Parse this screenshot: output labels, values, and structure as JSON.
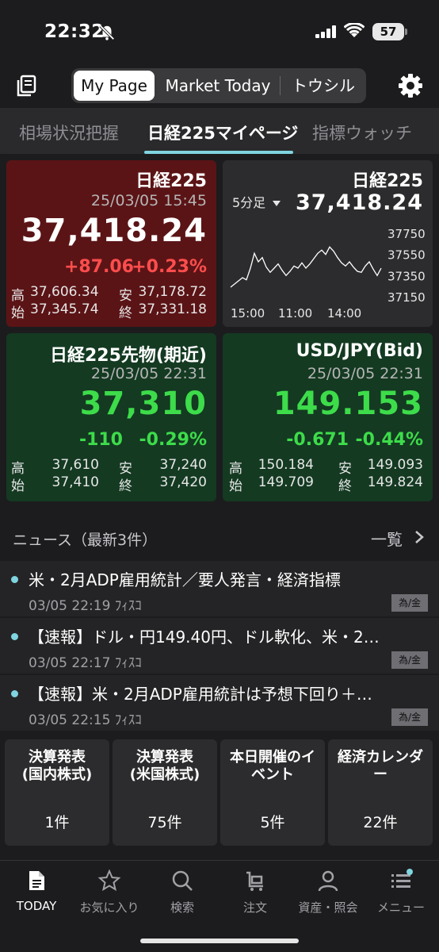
{
  "status": {
    "time": "22:32",
    "battery": "57"
  },
  "topbar": {
    "tabs": [
      {
        "label": "My Page"
      },
      {
        "label": "Market Today"
      },
      {
        "label": "トウシル"
      }
    ]
  },
  "subtabs": [
    {
      "label": "相場状況把握"
    },
    {
      "label": "日経225マイページ"
    },
    {
      "label": "指標ウォッチ"
    }
  ],
  "cards": {
    "nikkei": {
      "title": "日経225",
      "date": "25/03/05 15:45",
      "price": "37,418.24",
      "change": "+87.06",
      "change_pct": "+0.23%",
      "high_label": "高",
      "high": "37,606.34",
      "low_label": "安",
      "low": "37,178.72",
      "open_label": "始",
      "open": "37,345.74",
      "close_label": "終",
      "close": "37,331.18",
      "change_color": "#ff4d4d"
    },
    "chart_card": {
      "title": "日経225",
      "interval": "5分足",
      "price": "37,418.24",
      "y_ticks": [
        "37750",
        "37550",
        "37350",
        "37150"
      ],
      "x_ticks": [
        "15:00",
        "11:00",
        "14:00"
      ]
    },
    "futures": {
      "title": "日経225先物(期近)",
      "date": "25/03/05 22:31",
      "price": "37,310",
      "change": "-110",
      "change_pct": "-0.29%",
      "high_label": "高",
      "high": "37,610",
      "low_label": "安",
      "low": "37,240",
      "open_label": "始",
      "open": "37,410",
      "close_label": "終",
      "close": "37,420",
      "price_color": "#3ddc4a"
    },
    "usdjpy": {
      "title": "USD/JPY(Bid)",
      "date": "25/03/05 22:31",
      "price": "149.153",
      "change": "-0.671",
      "change_pct": "-0.44%",
      "high_label": "高",
      "high": "150.184",
      "low_label": "安",
      "low": "149.093",
      "open_label": "始",
      "open": "149.709",
      "close_label": "終",
      "close": "149.824",
      "price_color": "#3ddc4a"
    }
  },
  "chart_data": {
    "type": "line",
    "x": [
      "15:00",
      "11:00",
      "14:00"
    ],
    "series": [
      {
        "values": [
          37240,
          37270,
          37300,
          37330,
          37310,
          37420,
          37560,
          37480,
          37520,
          37430,
          37380,
          37420,
          37460,
          37400,
          37350,
          37390,
          37440,
          37420,
          37470,
          37420,
          37460,
          37510,
          37560,
          37590,
          37550,
          37620,
          37580,
          37520,
          37470,
          37440,
          37480,
          37430,
          37390,
          37380,
          37440,
          37480,
          37410,
          37350,
          37420
        ]
      }
    ],
    "ylim": [
      37150,
      37750
    ],
    "y_ticks": [
      37750,
      37550,
      37350,
      37150
    ]
  },
  "news": {
    "header": "ニュース（最新3件）",
    "all_label": "一覧",
    "items": [
      {
        "title": "米・2月ADP雇用統計／要人発言・経済指標",
        "time": "03/05 22:19",
        "source": "ﾌｨｽｺ",
        "tag": "為/金"
      },
      {
        "title": "【速報】ドル・円149.40円、ドル軟化、米・2…",
        "time": "03/05 22:17",
        "source": "ﾌｨｽｺ",
        "tag": "為/金"
      },
      {
        "title": "【速報】米・2月ADP雇用統計は予想下回り＋…",
        "time": "03/05 22:15",
        "source": "ﾌｨｽｺ",
        "tag": "為/金"
      }
    ]
  },
  "tiles": [
    {
      "title": "決算発表\n(国内株式)",
      "count": "1件"
    },
    {
      "title": "決算発表\n(米国株式)",
      "count": "75件"
    },
    {
      "title": "本日開催のイ\nベント",
      "count": "5件"
    },
    {
      "title": "経済カレンダ\nー",
      "count": "22件"
    }
  ],
  "bottomnav": [
    {
      "label": "TODAY",
      "icon": "today-doc-icon"
    },
    {
      "label": "お気に入り",
      "icon": "star-icon"
    },
    {
      "label": "検索",
      "icon": "search-icon"
    },
    {
      "label": "注文",
      "icon": "cart-icon"
    },
    {
      "label": "資産・照会",
      "icon": "person-icon"
    },
    {
      "label": "メニュー",
      "icon": "menu-icon"
    }
  ],
  "colors": {
    "accent": "#7fd4df",
    "up": "#ff4d4d",
    "down_green": "#3ddc4a"
  }
}
